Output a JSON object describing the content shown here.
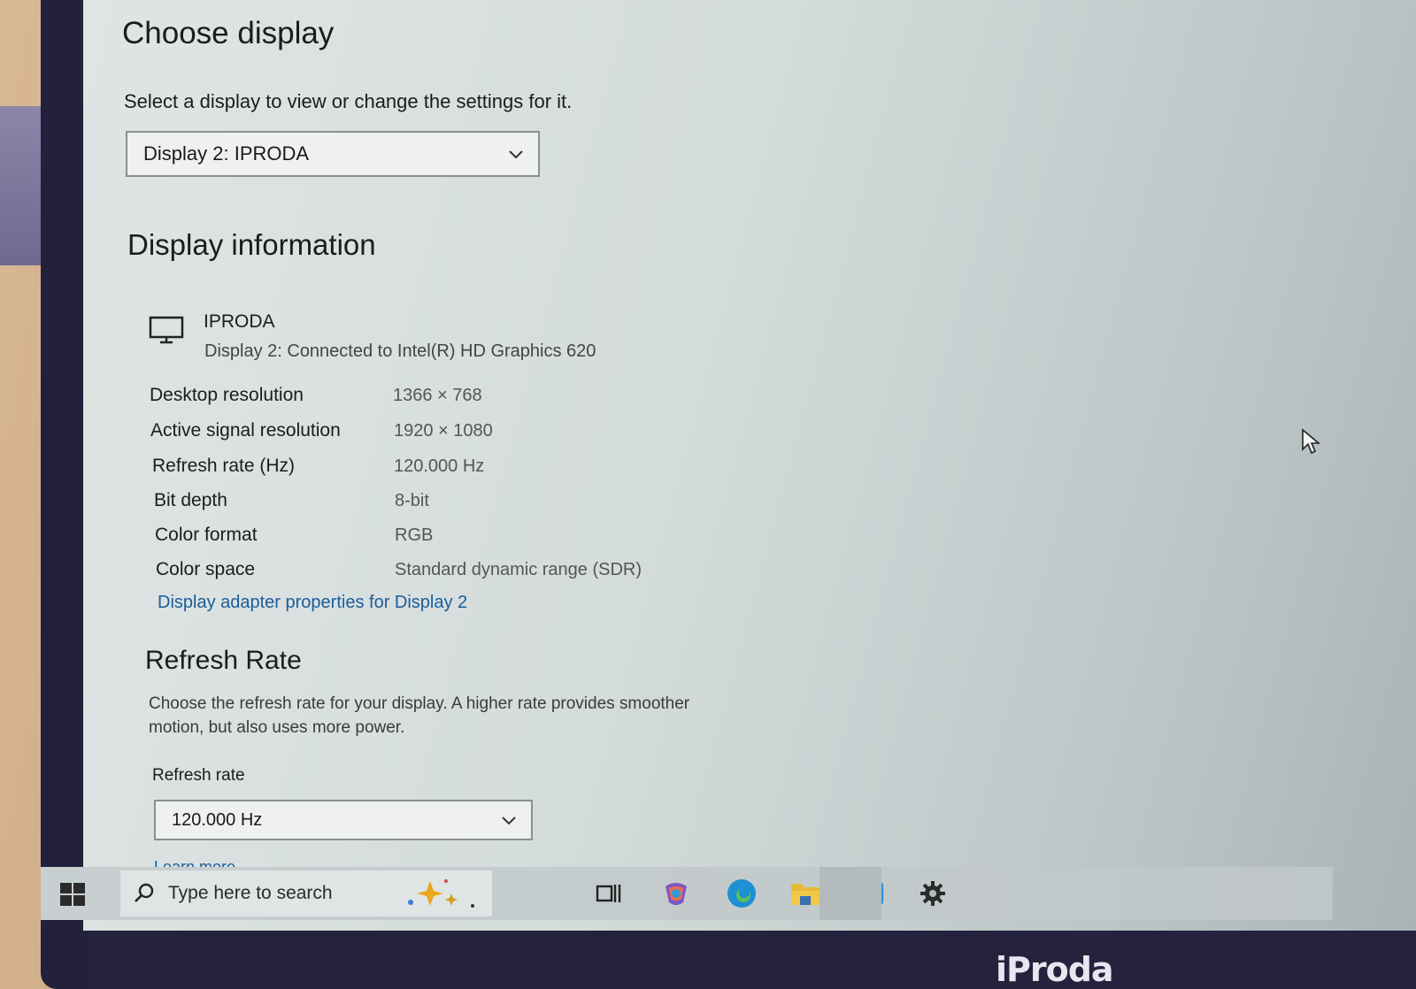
{
  "choose_display": {
    "title": "Choose display",
    "subtitle": "Select a display to view or change the settings for it.",
    "selected_display": "Display 2: IPRODA"
  },
  "display_info": {
    "title": "Display information",
    "monitor_name": "IPRODA",
    "monitor_desc": "Display 2: Connected to Intel(R) HD Graphics 620",
    "rows": [
      {
        "label": "Desktop resolution",
        "value": "1366 × 768"
      },
      {
        "label": "Active signal resolution",
        "value": "1920 × 1080"
      },
      {
        "label": "Refresh rate (Hz)",
        "value": "120.000 Hz"
      },
      {
        "label": "Bit depth",
        "value": "8-bit"
      },
      {
        "label": "Color format",
        "value": "RGB"
      },
      {
        "label": "Color space",
        "value": "Standard dynamic range (SDR)"
      }
    ],
    "adapter_link": "Display adapter properties for Display 2"
  },
  "refresh_rate": {
    "title": "Refresh Rate",
    "description": "Choose the refresh rate for your display. A higher rate provides smoother motion, but also uses more power.",
    "label": "Refresh rate",
    "selected": "120.000 Hz",
    "learn_more": "Learn more"
  },
  "taskbar": {
    "search_placeholder": "Type here to search",
    "icons": [
      "windows-start-icon",
      "search-icon",
      "task-view-icon",
      "copilot-icon",
      "edge-icon",
      "file-explorer-icon",
      "outlook-icon",
      "settings-icon"
    ]
  },
  "laptop": {
    "brand": "iProda"
  },
  "colors": {
    "link": "#1a5d9a",
    "bezel": "#22203a"
  }
}
